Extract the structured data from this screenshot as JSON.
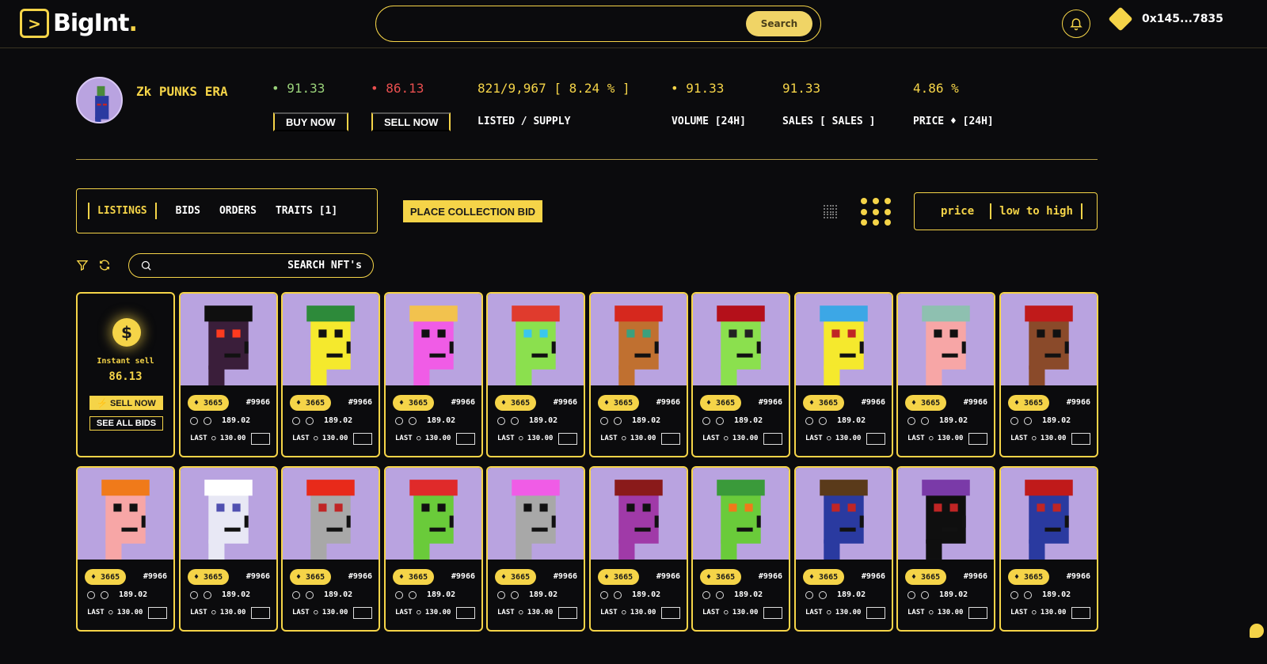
{
  "header": {
    "logo_glyph": ">",
    "logo_text": "BigInt",
    "logo_dot": ".",
    "search_placeholder": "",
    "search_button": "Search",
    "wallet_address": "0x145...7835"
  },
  "collection": {
    "name": "Zk PUNKS ERA",
    "buy_value": "• 91.33",
    "buy_label": "BUY NOW",
    "sell_value": "• 86.13",
    "sell_label": "SELL NOW",
    "listed_value": "821/9,967 [ 8.24 % ]",
    "listed_label": "LISTED / SUPPLY",
    "volume_value": "• 91.33",
    "volume_label": "VOLUME [24H]",
    "sales_value": "91.33",
    "sales_label": "SALES [ SALES ]",
    "price_change_value": "4.86 %",
    "price_change_label": "PRICE ♦ [24H]"
  },
  "tabs": [
    "LISTINGS",
    "BIDS",
    "ORDERS",
    "TRAITS [1]"
  ],
  "place_bid_label": "PLACE COLLECTION BID",
  "sort": {
    "label": "price",
    "value": "low to high"
  },
  "nft_search_placeholder": "SEARCH NFT's",
  "instant_sell": {
    "coin_glyph": "$",
    "label": "Instant sell",
    "value": "86.13",
    "sell_button": "⚡ SELL NOW",
    "see_bids_button": "SEE ALL BIDS"
  },
  "card_common": {
    "price": "♦ 3665",
    "id": "#9966",
    "bid": "189.02",
    "last": "LAST ○ 130.00"
  },
  "cards_row1": [
    {
      "skin": "#3a1e3a",
      "hat": "#0f0f0f",
      "eye": "#ff3b1f"
    },
    {
      "skin": "#f5e92d",
      "hat": "#2d8a3a",
      "eye": "#111111"
    },
    {
      "skin": "#f05ce6",
      "hat": "#f2c24e",
      "eye": "#111111"
    },
    {
      "skin": "#8be04e",
      "hat": "#e03b2d",
      "eye": "#3ac7ee"
    },
    {
      "skin": "#c07030",
      "hat": "#d6281e",
      "eye": "#3aa07d"
    },
    {
      "skin": "#8be04e",
      "hat": "#b4101a",
      "eye": "#222222"
    },
    {
      "skin": "#f5e92d",
      "hat": "#3ca7e6",
      "eye": "#c02525"
    },
    {
      "skin": "#f7a6a6",
      "hat": "#8ec0b0",
      "eye": "#111111"
    },
    {
      "skin": "#8a4a2a",
      "hat": "#c01a1a",
      "eye": "#111111"
    }
  ],
  "cards_row2": [
    {
      "skin": "#f7a6a6",
      "hat": "#f07a1a",
      "eye": "#111111"
    },
    {
      "skin": "#e8e8f5",
      "hat": "#ffffff",
      "eye": "#5050b0"
    },
    {
      "skin": "#a8a8a8",
      "hat": "#e82a1a",
      "eye": "#c02525"
    },
    {
      "skin": "#6acb3a",
      "hat": "#e02a2a",
      "eye": "#111111"
    },
    {
      "skin": "#a8a8a8",
      "hat": "#f05ce6",
      "eye": "#111111"
    },
    {
      "skin": "#a03aa8",
      "hat": "#8a1a1a",
      "eye": "#111111"
    },
    {
      "skin": "#6acb3a",
      "hat": "#3a9a3a",
      "eye": "#f07a1a"
    },
    {
      "skin": "#2a3aa0",
      "hat": "#5a3a1a",
      "eye": "#c02525"
    },
    {
      "skin": "#0f0f0f",
      "hat": "#7a3aa8",
      "eye": "#c02525"
    },
    {
      "skin": "#2a3aa0",
      "hat": "#c01a1a",
      "eye": "#c02525"
    }
  ]
}
